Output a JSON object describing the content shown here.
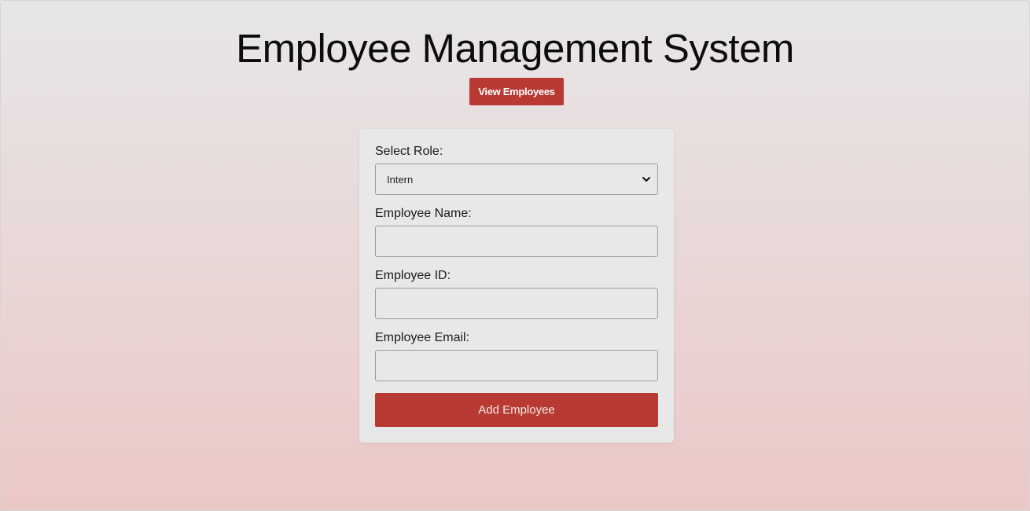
{
  "header": {
    "title": "Employee Management System",
    "view_button_label": "View Employees"
  },
  "form": {
    "role": {
      "label": "Select Role:",
      "selected_value": "Intern",
      "chevron_icon": "chevron-down-icon"
    },
    "name": {
      "label": "Employee Name:",
      "value": "",
      "placeholder": ""
    },
    "id": {
      "label": "Employee ID:",
      "value": "",
      "placeholder": ""
    },
    "email": {
      "label": "Employee Email:",
      "value": "",
      "placeholder": ""
    },
    "submit_label": "Add Employee"
  },
  "colors": {
    "accent": "#b83a33",
    "card_background": "#e8e8e8",
    "page_gradient_top": "#e7e6e7",
    "page_gradient_bottom": "#eac8c6"
  }
}
